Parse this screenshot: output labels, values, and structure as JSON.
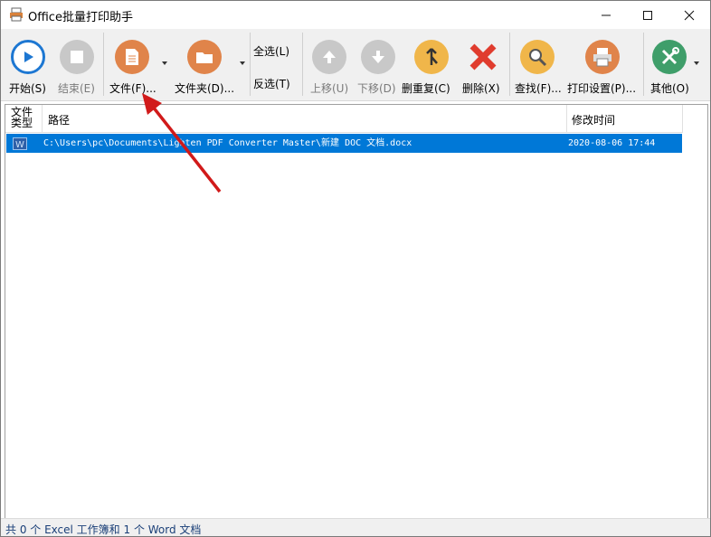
{
  "window": {
    "title": "Office批量打印助手"
  },
  "toolbar": {
    "start": "开始(S)",
    "stop": "结束(E)",
    "file": "文件(F)...",
    "folder": "文件夹(D)...",
    "select_all": "全选(L)",
    "invert": "反选(T)",
    "move_up": "上移(U)",
    "move_down": "下移(D)",
    "remove_dup": "删重复(C)",
    "delete": "删除(X)",
    "find": "查找(F)...",
    "print_settings": "打印设置(P)...",
    "other": "其他(O)"
  },
  "list": {
    "columns": {
      "type": "文件\n类型",
      "path": "路径",
      "modified": "修改时间"
    },
    "rows": [
      {
        "type_icon": "word-doc-icon",
        "path": "C:\\Users\\pc\\Documents\\Lighten PDF Converter Master\\新建 DOC 文档.docx",
        "modified": "2020-08-06 17:44"
      }
    ]
  },
  "status": {
    "text": "共 0 个 Excel 工作簿和 1 个 Word 文档"
  },
  "colors": {
    "accent": "#0078d7",
    "annotation_arrow": "#d11a1a"
  }
}
